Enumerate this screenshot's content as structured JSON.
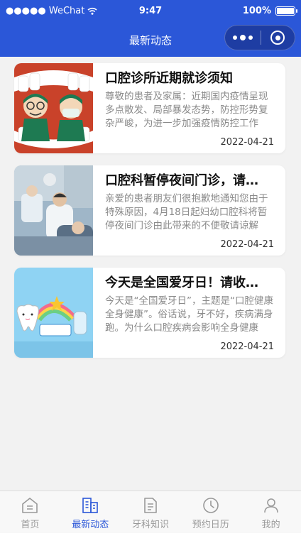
{
  "status_bar": {
    "carrier": "●●●●● WeChat",
    "time": "9:47",
    "battery": "100%"
  },
  "nav": {
    "title": "最新动态"
  },
  "articles": [
    {
      "title": "口腔诊所近期就诊须知",
      "desc": "尊敬的患者及家属：近期国内疫情呈现多点散发、局部暴发态势，防控形势复杂严峻，为进一步加强疫情防控工作",
      "date": "2022-04-21",
      "thumb": "dentist-cartoon-image"
    },
    {
      "title": "口腔科暂停夜间门诊，请…",
      "desc": "亲爱的患者朋友们很抱歉地通知您由于特殊原因，4月18日起妇幼口腔科将暂停夜间门诊由此带来的不便敬请谅解",
      "date": "2022-04-21",
      "thumb": "dental-clinic-photo"
    },
    {
      "title": "今天是全国爱牙日！请收…",
      "desc": "今天是“全国爱牙日”，主题是“口腔健康 全身健康”。俗话说，牙不好，疾病满身跑。为什么口腔疾病会影响全身健康",
      "date": "2022-04-21",
      "thumb": "tooth-day-cartoon"
    }
  ],
  "tabbar": {
    "tabs": [
      {
        "label": "首页",
        "icon": "home-icon",
        "active": false
      },
      {
        "label": "最新动态",
        "icon": "building-icon",
        "active": true
      },
      {
        "label": "牙科知识",
        "icon": "document-icon",
        "active": false
      },
      {
        "label": "预约日历",
        "icon": "clock-icon",
        "active": false
      },
      {
        "label": "我的",
        "icon": "user-icon",
        "active": false
      }
    ]
  },
  "colors": {
    "brand": "#2b57d8",
    "inactive": "#999999"
  }
}
